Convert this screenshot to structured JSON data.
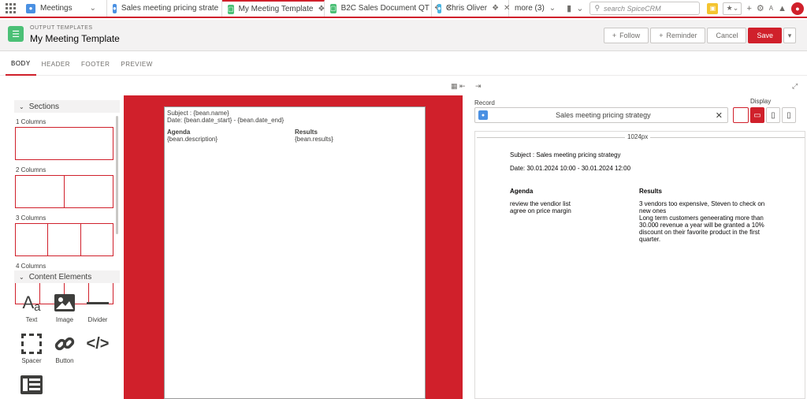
{
  "tabs": [
    {
      "label": "Meetings",
      "color": "#4a90e2",
      "icon": "user-icon",
      "dropdown": true
    },
    {
      "label": "Sales meeting pricing strate",
      "color": "#4a90e2",
      "icon": "user-icon"
    },
    {
      "label": "My Meeting Template",
      "color": "#4bc076",
      "icon": "template-icon",
      "active": true
    },
    {
      "label": "B2C Sales Document QT",
      "color": "#4bc076",
      "icon": "template-icon"
    },
    {
      "label": "Chris Oliver",
      "color": "#4ab5e2",
      "icon": "contact-icon"
    },
    {
      "label": "more (3)"
    }
  ],
  "search": {
    "placeholder": "search SpiceCRM"
  },
  "header": {
    "subtitle": "OUTPUT TEMPLATES",
    "title": "My Meeting Template",
    "follow": "Follow",
    "reminder": "Reminder",
    "cancel": "Cancel",
    "save": "Save"
  },
  "subtabs": [
    "BODY",
    "HEADER",
    "FOOTER",
    "PREVIEW"
  ],
  "sections": {
    "title": "Sections",
    "columns": [
      "1 Columns",
      "2 Columns",
      "3 Columns",
      "4 Columns"
    ]
  },
  "content_elements": {
    "title": "Content Elements",
    "items": [
      "Text",
      "Image",
      "Divider",
      "Spacer",
      "Button"
    ]
  },
  "editor": {
    "subject": "Subject : {bean.name}",
    "date": "Date: {bean.date_start} - {bean.date_end}",
    "agenda_label": "Agenda",
    "agenda_val": "{bean.description}",
    "results_label": "Results",
    "results_val": "{bean.results}"
  },
  "record": {
    "label": "Record",
    "value": "Sales meeting pricing strategy"
  },
  "display": {
    "label": "Display"
  },
  "preview": {
    "width_label": "1024px",
    "subject": "Subject : Sales meeting pricing strategy",
    "date": "Date: 30.01.2024 10:00 - 30.01.2024 12:00",
    "agenda_label": "Agenda",
    "agenda_lines": [
      "review the vendior list",
      "agree on price margin"
    ],
    "results_label": "Results",
    "results_lines": [
      "3 vendors too expensive, Steven to check on",
      "new ones",
      "Long term customers geneerating more than",
      "30.000 revenue a year will be granted a 10%",
      "discount on their favorite product in the first",
      "quarter."
    ]
  }
}
